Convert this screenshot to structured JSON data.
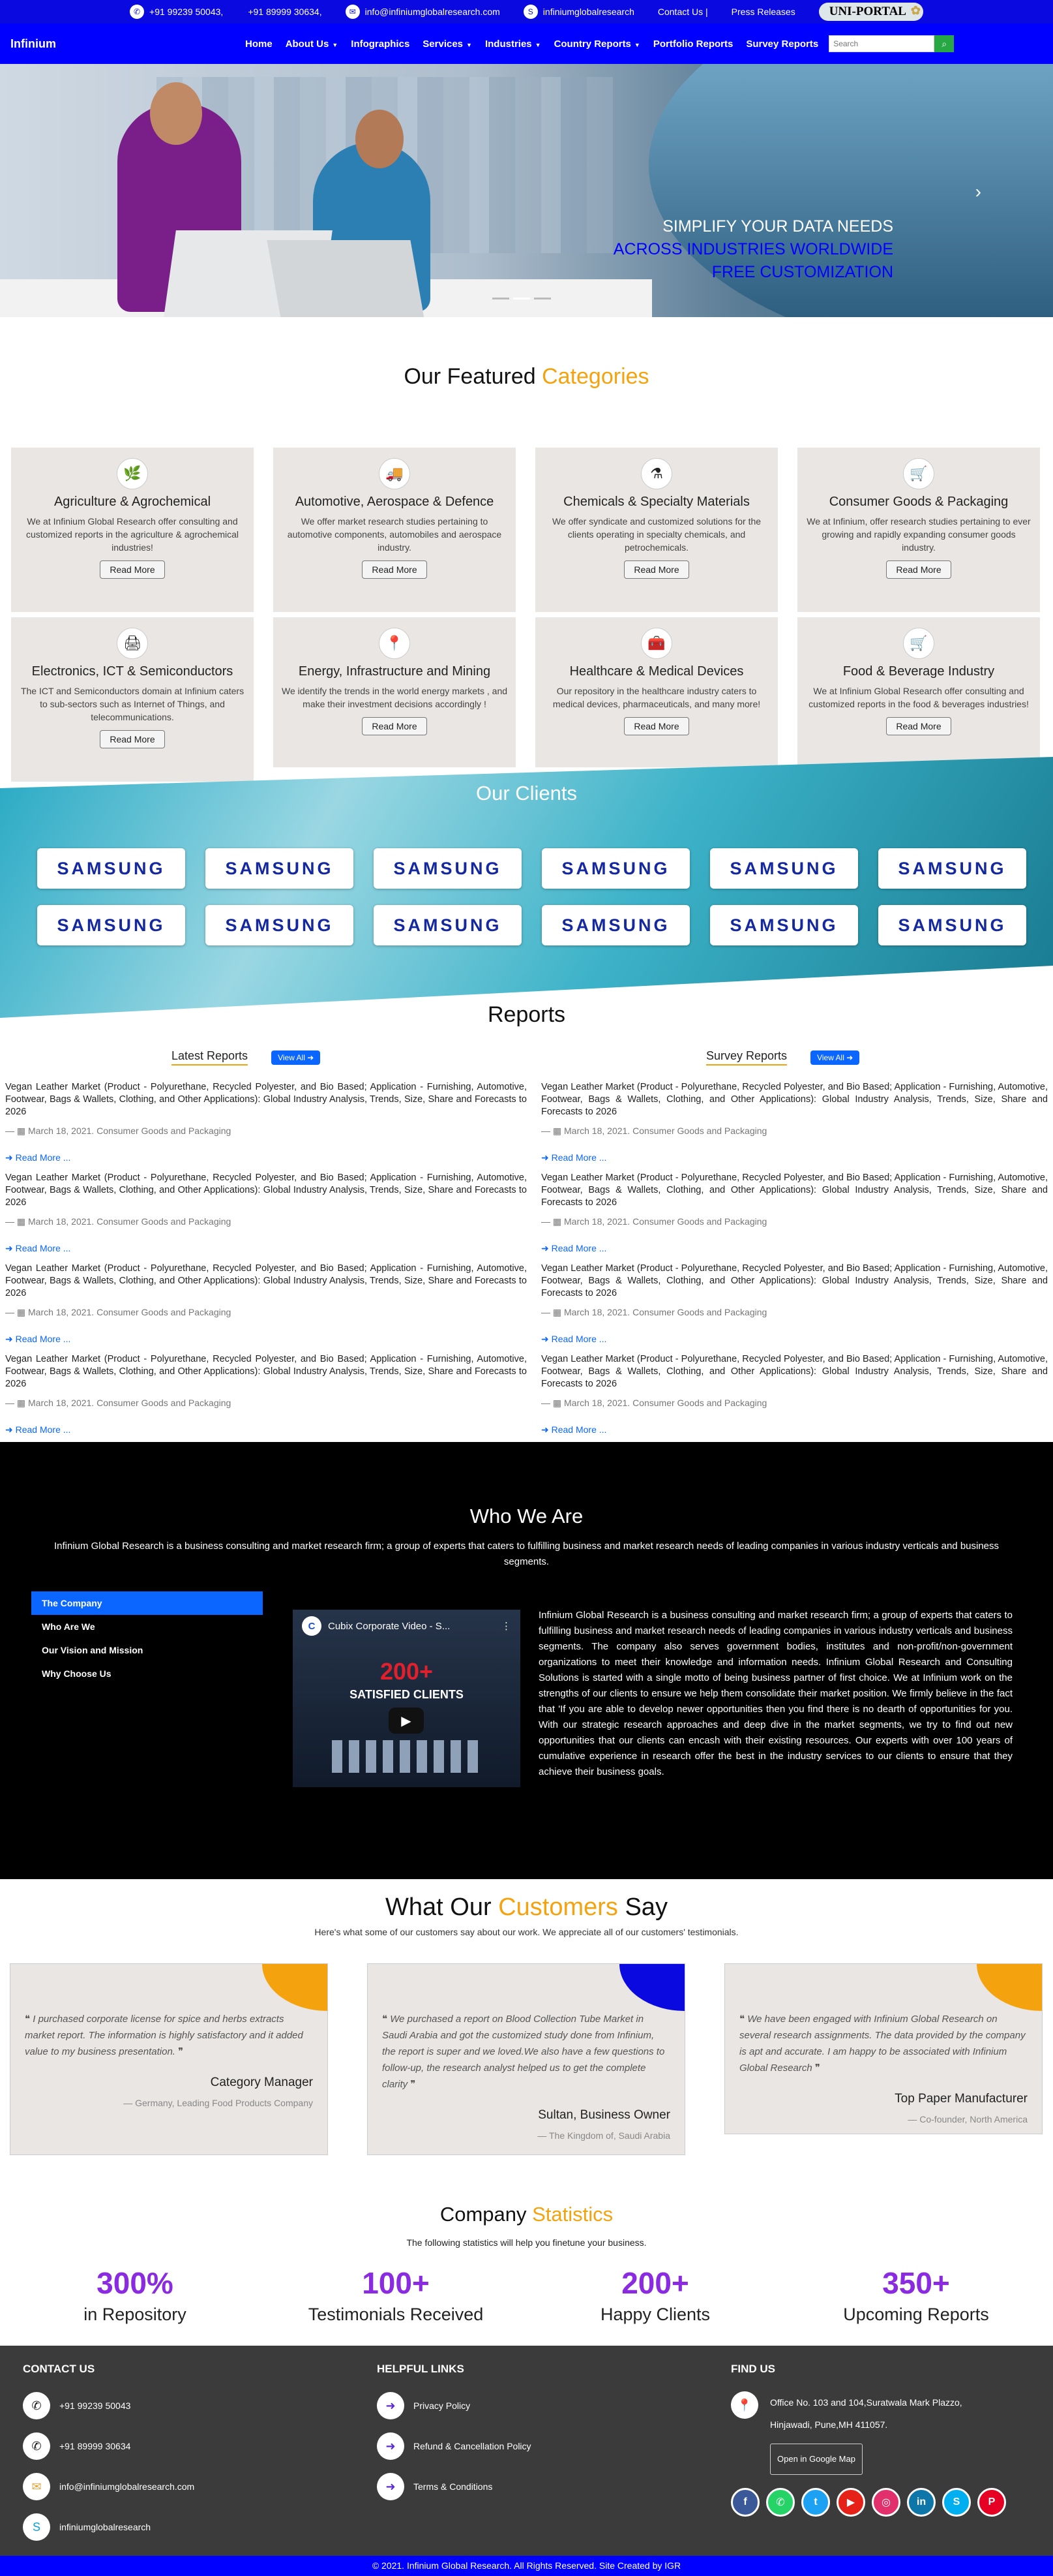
{
  "topbar": {
    "phone1": "+91 99239 50043,",
    "phone2": "+91 89999 30634,",
    "email": "info@infiniumglobalresearch.com",
    "skype": "infiniumglobalresearch",
    "contact": "Contact Us |",
    "press": "Press Releases",
    "uniportal": "UNI-PORTAL"
  },
  "nav": {
    "brand": "Infinium",
    "items": [
      "Home",
      "About Us",
      "Infographics",
      "Services",
      "Industries",
      "Country Reports",
      "Portfolio Reports",
      "Survey Reports"
    ],
    "search_placeholder": "Search"
  },
  "hero": {
    "line1": "SIMPLIFY YOUR DATA NEEDS",
    "line2": "ACROSS INDUSTRIES WORLDWIDE",
    "line3": "FREE CUSTOMIZATION"
  },
  "featured": {
    "title_a": "Our Featured ",
    "title_b": "Categories",
    "read_more": "Read More",
    "cards": [
      {
        "icon": "leaf-icon",
        "glyph": "🌿",
        "title": "Agriculture & Agrochemical",
        "text": "We at Infinium Global Research offer consulting and customized reports in the agriculture & agrochemical industries!"
      },
      {
        "icon": "truck-icon",
        "glyph": "🚚",
        "title": "Automotive, Aerospace & Defence",
        "text": "We offer market research studies pertaining to automotive components, automobiles and aerospace industry."
      },
      {
        "icon": "flask-icon",
        "glyph": "⚗",
        "title": "Chemicals & Specialty Materials",
        "text": "We offer syndicate and customized solutions for the clients operating in specialty chemicals, and petrochemicals."
      },
      {
        "icon": "cart-icon",
        "glyph": "🛒",
        "title": "Consumer Goods & Packaging",
        "text": "We at Infinium, offer research studies pertaining to ever growing and rapidly expanding consumer goods industry."
      },
      {
        "icon": "printer-icon",
        "glyph": "🖨",
        "title": "Electronics, ICT & Semiconductors",
        "text": "The ICT and Semiconductors domain at Infinium caters to sub-sectors such as Internet of Things, and telecommunications."
      },
      {
        "icon": "map-pin-icon",
        "glyph": "📍",
        "title": "Energy, Infrastructure and Mining",
        "text": "We identify the trends in the world energy markets , and make their investment decisions accordingly !"
      },
      {
        "icon": "medkit-icon",
        "glyph": "🧰",
        "title": "Healthcare & Medical Devices",
        "text": "Our repository in the healthcare industry caters to medical devices, pharmaceuticals, and many more!"
      },
      {
        "icon": "cart-icon",
        "glyph": "🛒",
        "title": "Food & Beverage Industry",
        "text": "We at Infinium Global Research offer consulting and customized reports in the food & beverages industries!"
      }
    ]
  },
  "clients": {
    "title": "Our Clients",
    "logos": [
      "SAMSUNG",
      "SAMSUNG",
      "SAMSUNG",
      "SAMSUNG",
      "SAMSUNG",
      "SAMSUNG",
      "SAMSUNG",
      "SAMSUNG",
      "SAMSUNG",
      "SAMSUNG",
      "SAMSUNG",
      "SAMSUNG"
    ]
  },
  "reports": {
    "title": "Reports",
    "view_all": "View All",
    "read_more": "Read More ...",
    "latest_title": "Latest Reports",
    "survey_title": "Survey Reports",
    "item_text": "Vegan Leather Market (Product - Polyurethane, Recycled Polyester, and Bio Based; Application - Furnishing, Automotive, Footwear, Bags & Wallets, Clothing, and Other Applications): Global Industry Analysis, Trends, Size, Share and Forecasts to 2026",
    "item_date": "March 18, 2021. Consumer Goods and Packaging"
  },
  "who": {
    "title": "Who We Are",
    "intro": "Infinium Global Research is a business consulting and market research firm; a group of experts that caters to fulfilling business and market research needs of leading companies in various industry verticals and business segments.",
    "tabs": [
      "The Company",
      "Who Are We",
      "Our Vision and Mission",
      "Why Choose Us"
    ],
    "video_title": "Cubix Corporate Video - S...",
    "video_big": "200+",
    "video_sub": "SATISFIED CLIENTS",
    "body": "Infinium Global Research is a business consulting and market research firm; a group of experts that caters to fulfilling business and market research needs of leading companies in various industry verticals and business segments. The company also serves government bodies, institutes and non-profit/non-government organizations to meet their knowledge and information needs. Infinium Global Research and Consulting Solutions is started with a single motto of being business partner of first choice. We at Infinium work on the strengths of our clients to ensure we help them consolidate their market position. We firmly believe in the fact that 'If you are able to develop newer opportunities then you find there is no dearth of opportunities for you. With our strategic research approaches and deep dive in the market segments, we try to find out new opportunities that our clients can encash with their existing resources. Our experts with over 100 years of cumulative experience in research offer the best in the industry services to our clients to ensure that they achieve their business goals."
  },
  "testimonials": {
    "title_a": "What Our ",
    "title_b": "Customers",
    "title_c": " Say",
    "sub": "Here's what some of our customers say about our work. We appreciate all of our customers' testimonials.",
    "cards": [
      {
        "quote": "I purchased corporate license for spice and herbs extracts market report. The information is highly satisfactory and it added value to my business presentation.",
        "name": "Category Manager",
        "org": "— Germany, Leading Food Products Company",
        "color": "#f4a30f"
      },
      {
        "quote": "We purchased a report on Blood Collection Tube Market in Saudi Arabia and got the customized study done from Infinium, the report is super and we loved.We also have a few questions to follow-up, the research analyst helped us to get the complete clarity",
        "name": "Sultan, Business Owner",
        "org": "— The Kingdom of, Saudi Arabia",
        "color": "#0a0ae0"
      },
      {
        "quote": "We have been engaged with Infinium Global Research on several research assignments. The data provided by the company is apt and accurate. I am happy to be associated with Infinium Global Research",
        "name": "Top Paper Manufacturer",
        "org": "— Co-founder, North America",
        "color": "#f4a30f"
      }
    ]
  },
  "stats": {
    "title_a": "Company ",
    "title_b": "Statistics",
    "sub": "The following statistics will help you finetune your business.",
    "items": [
      {
        "value": "300%",
        "label": "in Repository"
      },
      {
        "value": "100+",
        "label": "Testimonials Received"
      },
      {
        "value": "200+",
        "label": "Happy Clients"
      },
      {
        "value": "350+",
        "label": "Upcoming Reports"
      }
    ]
  },
  "footer": {
    "contact_title": "CONTACT US",
    "phone1": "+91 99239 50043",
    "phone2": "+91 89999 30634",
    "email": "info@infiniumglobalresearch.com",
    "skype": "infiniumglobalresearch",
    "links_title": "HELPFUL LINKS",
    "links": [
      "Privacy Policy",
      "Refund & Cancellation Policy",
      "Terms & Conditions"
    ],
    "find_title": "FIND US",
    "address1": "Office No. 103 and 104,Suratwala Mark Plazzo,",
    "address2": "Hinjawadi, Pune,MH 411057.",
    "map_button": "Open in Google Map",
    "copyright": "© 2021. Infinium Global Research. All Rights Reserved. Site Created by IGR"
  }
}
